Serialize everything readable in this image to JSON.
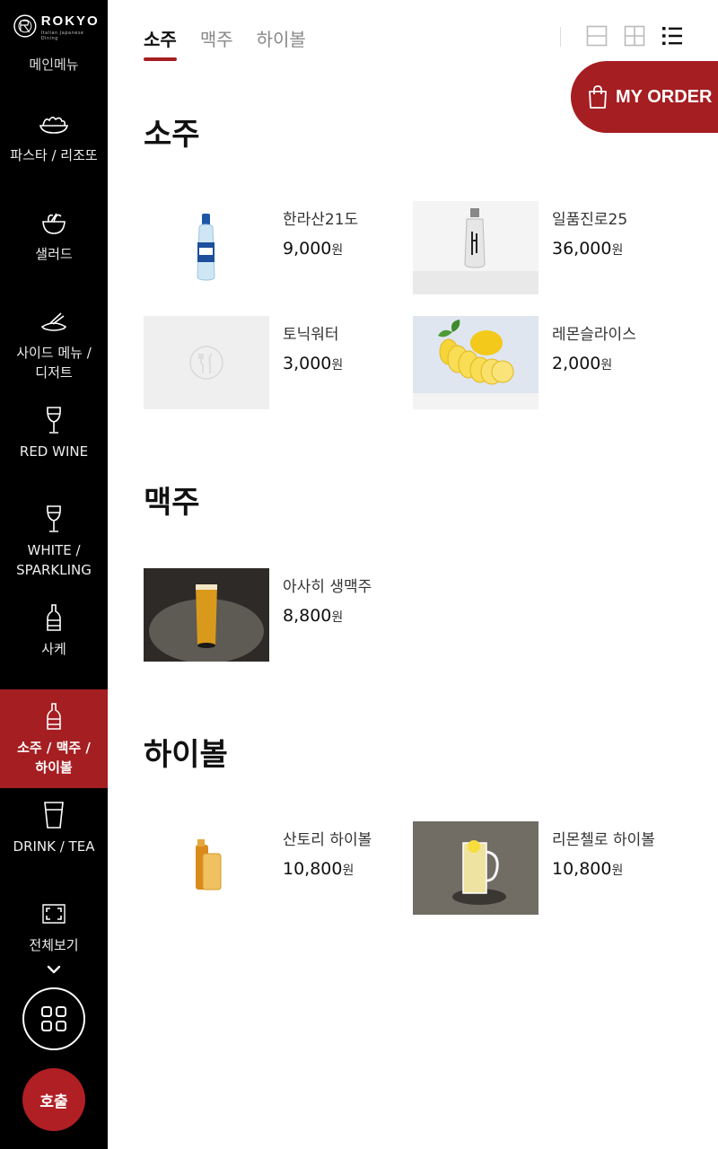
{
  "brand": {
    "name": "ROKYO",
    "tagline": "Italian Japanese Dining"
  },
  "sidebar": {
    "cut_item": "메인메뉴",
    "items": [
      {
        "label": "파스타 / 리조또",
        "icon": "pasta-bowl-icon"
      },
      {
        "label": "샐러드",
        "icon": "salad-bowl-icon"
      },
      {
        "label": "사이드 메뉴 / 디저트",
        "icon": "side-dish-icon"
      },
      {
        "label": "RED WINE",
        "icon": "wine-glass-icon"
      },
      {
        "label": "WHITE / SPARKLING",
        "icon": "wine-glass-icon"
      },
      {
        "label": "사케",
        "icon": "sake-bottle-icon"
      },
      {
        "label": "소주 / 맥주 / 하이볼",
        "icon": "soju-bottle-icon",
        "active": true
      },
      {
        "label": "DRINK / TEA",
        "icon": "cup-icon"
      },
      {
        "label": "전체보기",
        "icon": "expand-icon"
      }
    ],
    "call_label": "호출"
  },
  "tabs": [
    {
      "label": "소주",
      "active": true
    },
    {
      "label": "맥주",
      "active": false
    },
    {
      "label": "하이볼",
      "active": false
    }
  ],
  "order_button": "MY ORDER",
  "sections": [
    {
      "title": "소주",
      "items": [
        {
          "name": "한라산21도",
          "price": "9,000",
          "unit": "원"
        },
        {
          "name": "일품진로25",
          "price": "36,000",
          "unit": "원"
        },
        {
          "name": "토닉워터",
          "price": "3,000",
          "unit": "원"
        },
        {
          "name": "레몬슬라이스",
          "price": "2,000",
          "unit": "원"
        }
      ]
    },
    {
      "title": "맥주",
      "items": [
        {
          "name": "아사히 생맥주",
          "price": "8,800",
          "unit": "원"
        }
      ]
    },
    {
      "title": "하이볼",
      "items": [
        {
          "name": "산토리 하이볼",
          "price": "10,800",
          "unit": "원"
        },
        {
          "name": "리몬첼로 하이볼",
          "price": "10,800",
          "unit": "원"
        }
      ]
    }
  ],
  "colors": {
    "accent": "#a51e22",
    "sidebar_bg": "#000000"
  }
}
